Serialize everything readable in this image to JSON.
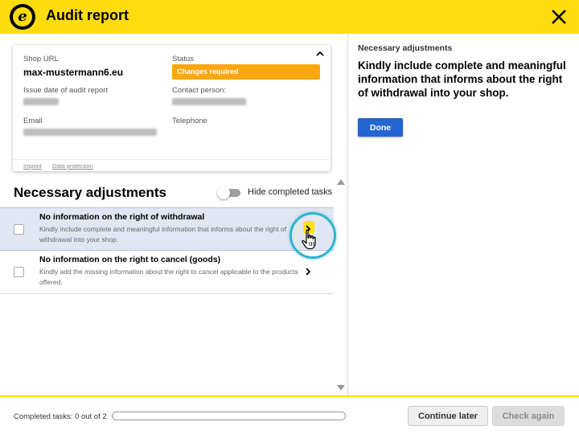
{
  "header": {
    "title": "Audit report",
    "logo_letter": "e"
  },
  "card": {
    "shop_url_label": "Shop URL",
    "shop_url": "max-mustermann6.eu",
    "status_label": "Status",
    "status": "Changes required",
    "issue_date_label": "Issue date of audit report",
    "contact_label": "Contact person:",
    "email_label": "Email",
    "telephone_label": "Telephone",
    "imprint_link": "Imprint",
    "data_protection_link": "Data protection",
    "status_color": "#FCA70D"
  },
  "tasks_section": {
    "title": "Necessary adjustments",
    "toggle_label": "Hide completed tasks",
    "toggle_on": false,
    "items": [
      {
        "title": "No information on the right of withdrawal",
        "description": "Kindly include complete and meaningful information that informs about the right of withdrawal into your shop.",
        "selected": true,
        "completed": false
      },
      {
        "title": "No information on the right to cancel (goods)",
        "description": "Kindly add the missing information about the right to cancel applicable to the products offered.",
        "selected": false,
        "completed": false
      }
    ]
  },
  "detail": {
    "heading": "Necessary adjustments",
    "text": "Kindly include complete and meaningful information that informs about the right of withdrawal into your shop.",
    "done_label": "Done"
  },
  "footer": {
    "progress_label": "Completed tasks: 0 out of 2",
    "progress_fraction": 0,
    "continue_label": "Continue later",
    "check_label": "Check again"
  },
  "colors": {
    "brand": "#FFDC0F",
    "primary": "#2366D1",
    "highlight_ring": "#2FB3CF"
  },
  "icons": [
    "trusted-logo-icon",
    "close-icon",
    "chevron-up-icon",
    "chevron-right-icon",
    "hand-cursor-icon",
    "scroll-up-icon",
    "scroll-down-icon"
  ]
}
